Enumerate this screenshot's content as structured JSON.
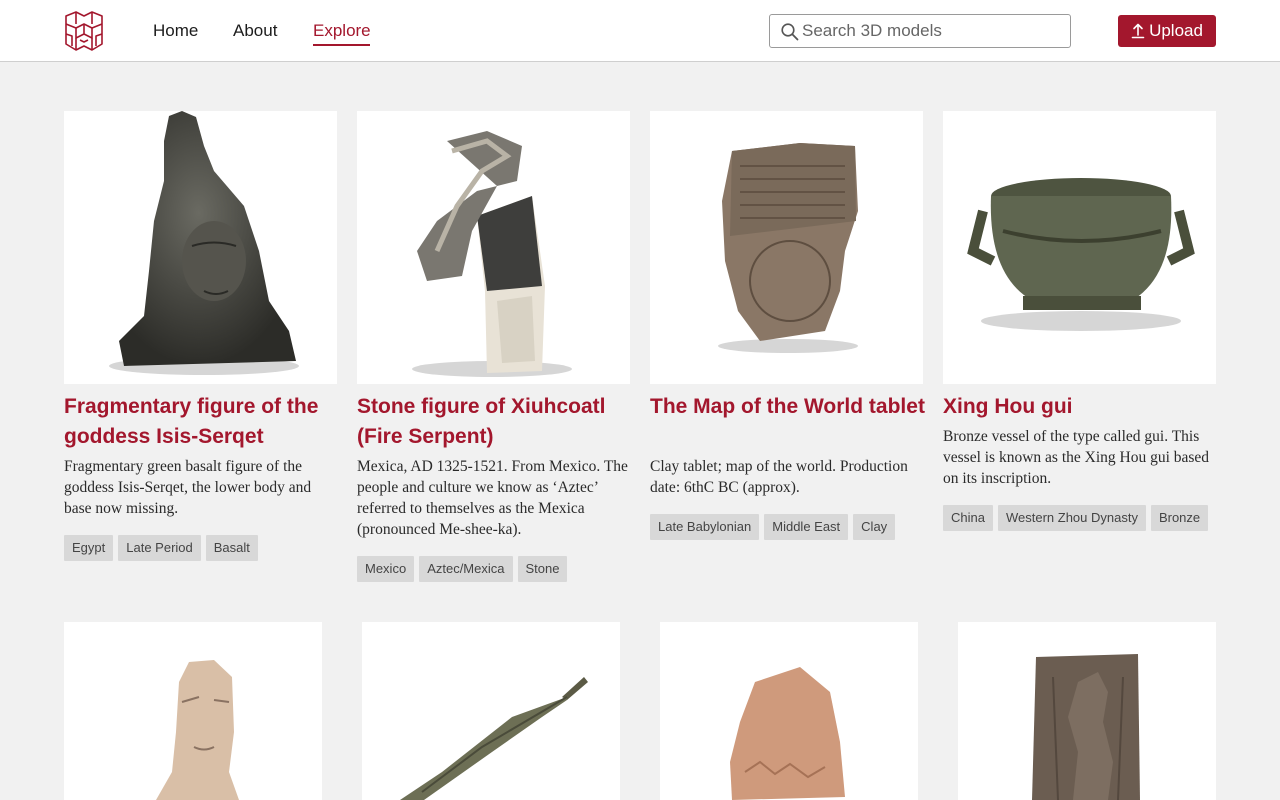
{
  "nav": {
    "home": "Home",
    "about": "About",
    "explore": "Explore",
    "active": "Explore"
  },
  "search": {
    "placeholder": "Search 3D models",
    "value": ""
  },
  "upload": {
    "label": "Upload"
  },
  "colors": {
    "accent": "#a3172d",
    "background": "#f1f1f1",
    "tag_bg": "#d8d8d8"
  },
  "cards": [
    {
      "title": "Fragmentary figure of the goddess Isis-Serqet",
      "description": "Fragmentary green basalt figure of the goddess Isis-Serqet, the lower body and base now missing.",
      "tags": [
        "Egypt",
        "Late Period",
        "Basalt"
      ]
    },
    {
      "title": "Stone figure of Xiuhcoatl (Fire Serpent)",
      "description": "Mexica, AD 1325-1521. From Mexico. The people and culture we know as ‘Aztec’ referred to themselves as the Mexica (pronounced Me-shee-ka).",
      "tags": [
        "Mexico",
        "Aztec/Mexica",
        "Stone"
      ]
    },
    {
      "title": "The Map of the World tablet",
      "description": "Clay tablet; map of the world. Production date: 6thC BC (approx).",
      "tags": [
        "Late Babylonian",
        "Middle East",
        "Clay"
      ]
    },
    {
      "title": "Xing Hou gui",
      "description": "Bronze vessel of the type called gui. This vessel is known as the Xing Hou gui based on its inscription.",
      "tags": [
        "China",
        "Western Zhou Dynasty",
        "Bronze"
      ]
    }
  ],
  "row2_models": [
    "marble-head",
    "bronze-spearhead",
    "terracotta-foot",
    "relief-panel"
  ]
}
